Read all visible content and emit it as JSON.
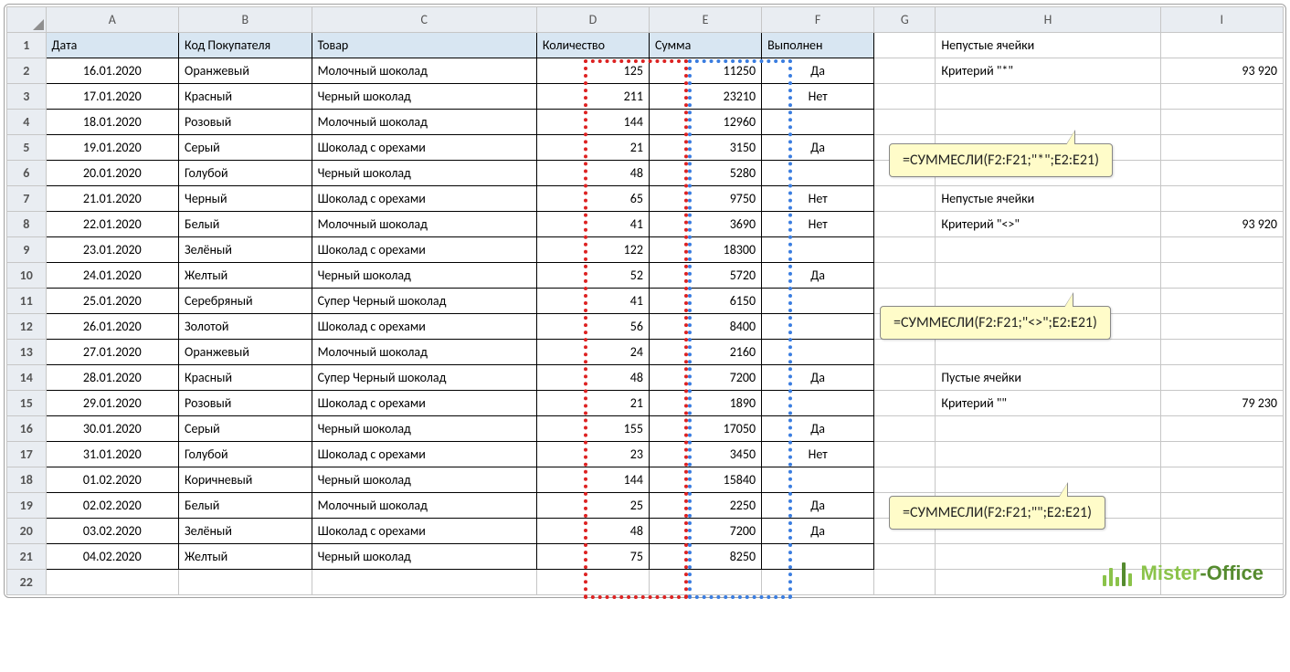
{
  "columns": [
    "A",
    "B",
    "C",
    "D",
    "E",
    "F",
    "G",
    "H",
    "I"
  ],
  "headers": {
    "A": "Дата",
    "B": "Код Покупателя",
    "C": "Товар",
    "D": "Количество",
    "E": "Сумма",
    "F": "Выполнен"
  },
  "rows": [
    {
      "r": 2,
      "date": "16.01.2020",
      "buyer": "Оранжевый",
      "product": "Молочный шоколад",
      "qty": "125",
      "sum": "11250",
      "done": "Да"
    },
    {
      "r": 3,
      "date": "17.01.2020",
      "buyer": "Красный",
      "product": "Черный шоколад",
      "qty": "211",
      "sum": "23210",
      "done": "Нет"
    },
    {
      "r": 4,
      "date": "18.01.2020",
      "buyer": "Розовый",
      "product": "Молочный шоколад",
      "qty": "144",
      "sum": "12960",
      "done": ""
    },
    {
      "r": 5,
      "date": "19.01.2020",
      "buyer": "Серый",
      "product": "Шоколад с орехами",
      "qty": "21",
      "sum": "3150",
      "done": "Да"
    },
    {
      "r": 6,
      "date": "20.01.2020",
      "buyer": "Голубой",
      "product": "Черный шоколад",
      "qty": "48",
      "sum": "5280",
      "done": ""
    },
    {
      "r": 7,
      "date": "21.01.2020",
      "buyer": "Черный",
      "product": "Шоколад с орехами",
      "qty": "65",
      "sum": "9750",
      "done": "Нет"
    },
    {
      "r": 8,
      "date": "22.01.2020",
      "buyer": "Белый",
      "product": "Молочный шоколад",
      "qty": "41",
      "sum": "3690",
      "done": "Нет"
    },
    {
      "r": 9,
      "date": "23.01.2020",
      "buyer": "Зелёный",
      "product": "Шоколад с орехами",
      "qty": "122",
      "sum": "18300",
      "done": ""
    },
    {
      "r": 10,
      "date": "24.01.2020",
      "buyer": "Желтый",
      "product": "Черный шоколад",
      "qty": "52",
      "sum": "5720",
      "done": "Да"
    },
    {
      "r": 11,
      "date": "25.01.2020",
      "buyer": "Серебряный",
      "product": "Супер Черный шоколад",
      "qty": "41",
      "sum": "6150",
      "done": ""
    },
    {
      "r": 12,
      "date": "26.01.2020",
      "buyer": "Золотой",
      "product": "Шоколад с орехами",
      "qty": "56",
      "sum": "8400",
      "done": ""
    },
    {
      "r": 13,
      "date": "27.01.2020",
      "buyer": "Оранжевый",
      "product": "Молочный шоколад",
      "qty": "24",
      "sum": "2160",
      "done": ""
    },
    {
      "r": 14,
      "date": "28.01.2020",
      "buyer": "Красный",
      "product": "Супер Черный шоколад",
      "qty": "48",
      "sum": "7200",
      "done": "Да"
    },
    {
      "r": 15,
      "date": "29.01.2020",
      "buyer": "Розовый",
      "product": "Шоколад с орехами",
      "qty": "21",
      "sum": "1890",
      "done": ""
    },
    {
      "r": 16,
      "date": "30.01.2020",
      "buyer": "Серый",
      "product": "Черный шоколад",
      "qty": "155",
      "sum": "17050",
      "done": "Да"
    },
    {
      "r": 17,
      "date": "31.01.2020",
      "buyer": "Голубой",
      "product": "Шоколад с орехами",
      "qty": "23",
      "sum": "3450",
      "done": "Нет"
    },
    {
      "r": 18,
      "date": "01.02.2020",
      "buyer": "Коричневый",
      "product": "Черный шоколад",
      "qty": "144",
      "sum": "15840",
      "done": ""
    },
    {
      "r": 19,
      "date": "02.02.2020",
      "buyer": "Белый",
      "product": "Молочный шоколад",
      "qty": "25",
      "sum": "2250",
      "done": "Да"
    },
    {
      "r": 20,
      "date": "03.02.2020",
      "buyer": "Зелёный",
      "product": "Шоколад с орехами",
      "qty": "48",
      "sum": "7200",
      "done": "Да"
    },
    {
      "r": 21,
      "date": "04.02.2020",
      "buyer": "Желтый",
      "product": "Черный шоколад",
      "qty": "75",
      "sum": "8250",
      "done": ""
    }
  ],
  "side": {
    "block1": {
      "title": "Непустые ячейки",
      "criteria": "Критерий \"*\"",
      "result": "93 920",
      "formula": "=СУММЕСЛИ(F2:F21;\"*\";E2:E21)"
    },
    "block2": {
      "title": "Непустые ячейки",
      "criteria": "Критерий \"<>\"",
      "result": "93 920",
      "formula": "=СУММЕСЛИ(F2:F21;\"<>\";E2:E21)"
    },
    "block3": {
      "title": "Пустые ячейки",
      "criteria": "Критерий \"\"",
      "result": "79 230",
      "formula": "=СУММЕСЛИ(F2:F21;\"\";E2:E21)"
    }
  },
  "logo": {
    "text1": "Mister",
    "text2": "-Office"
  }
}
